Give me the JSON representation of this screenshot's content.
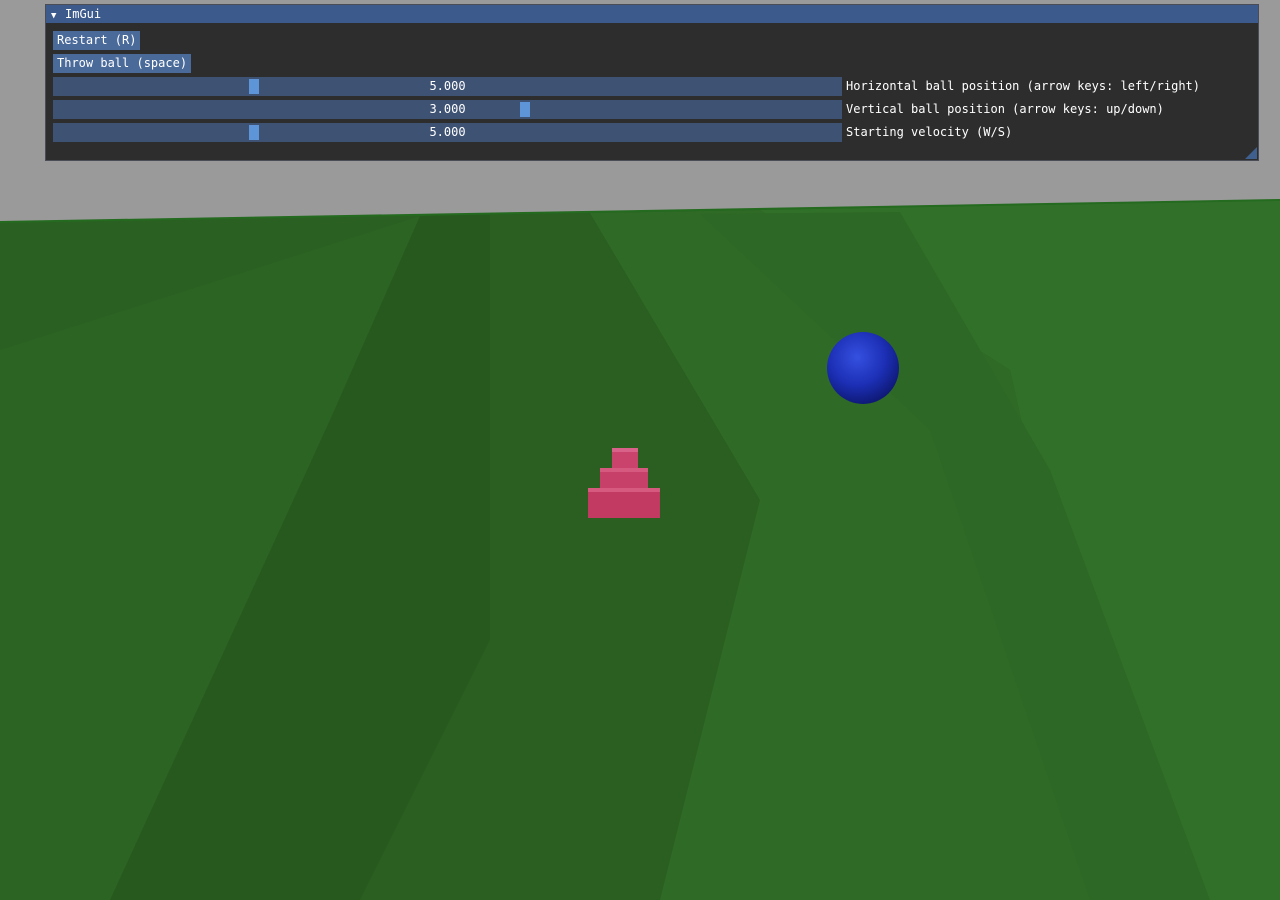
{
  "window": {
    "title": "ImGui",
    "collapse_icon": "triangle-down"
  },
  "buttons": {
    "restart_label": "Restart (R)",
    "throw_label": "Throw ball (space)"
  },
  "sliders": [
    {
      "label": "Horizontal ball position (arrow keys: left/right)",
      "value": "5.000"
    },
    {
      "label": "Vertical ball position (arrow keys: up/down)",
      "value": "3.000"
    },
    {
      "label": "Starting velocity (W/S)",
      "value": "5.000"
    }
  ],
  "colors": {
    "sky": "#9a9a9a",
    "ground": "#2a5e20",
    "ball": "#1f2fb0",
    "target": "#c23a62",
    "titlebar": "#3d5a8c",
    "slider_grab": "#5d95d8"
  }
}
